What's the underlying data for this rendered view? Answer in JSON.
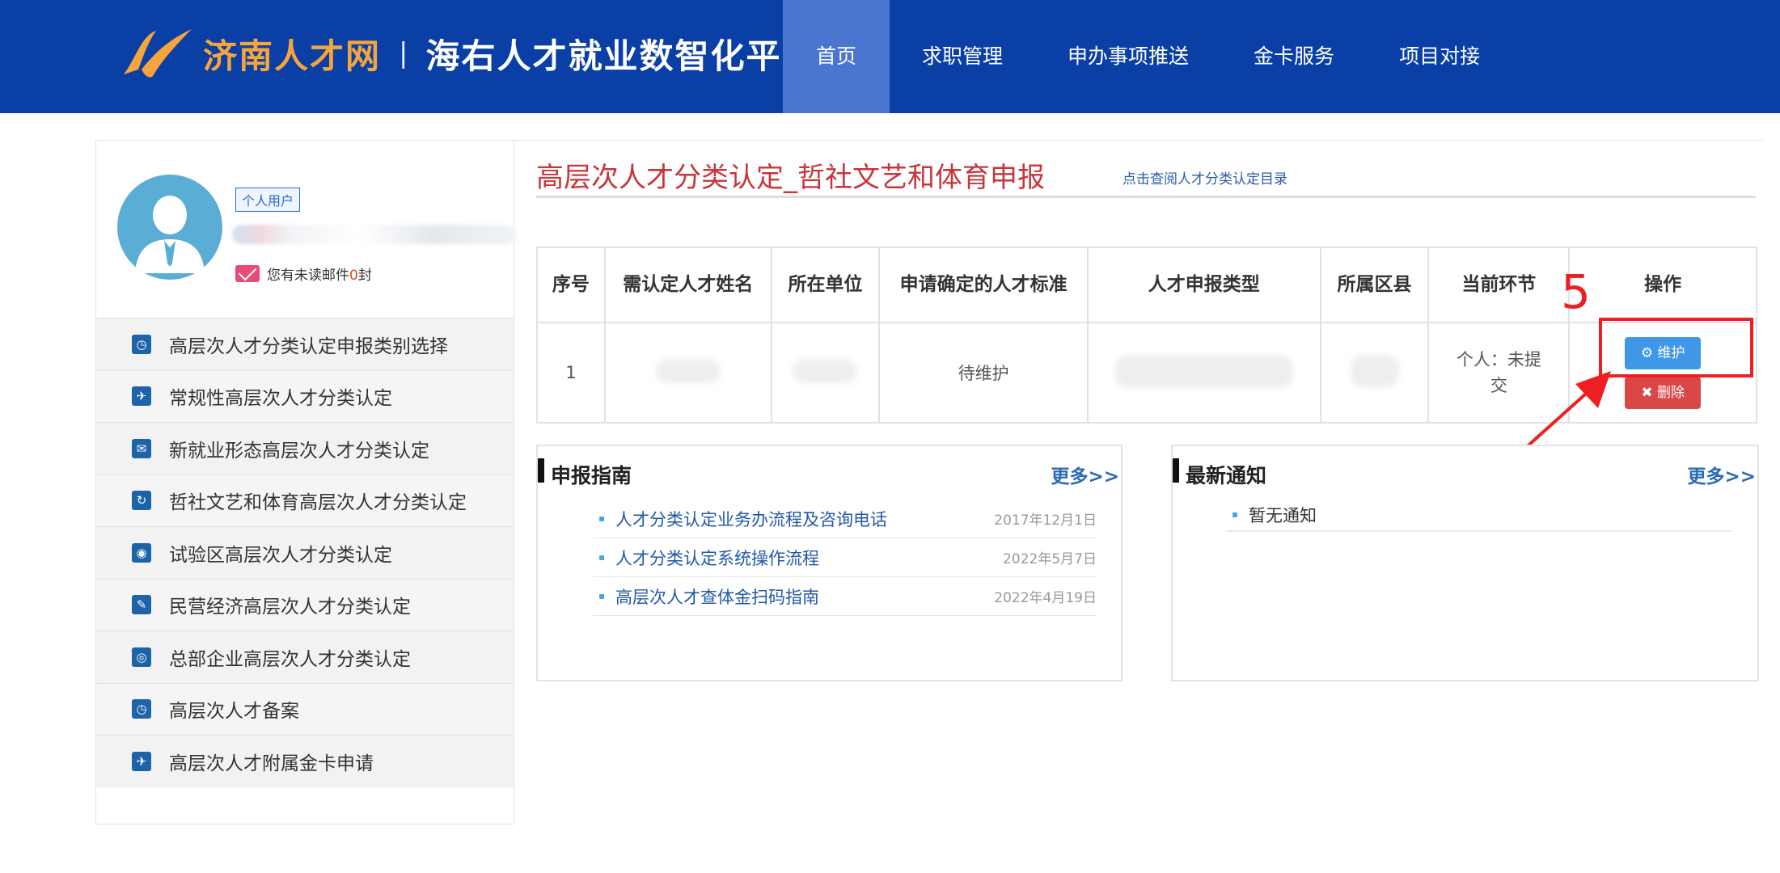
{
  "header": {
    "site_name": "济南人才网",
    "separator": "|",
    "platform_name": "海右人才就业数智化平台",
    "nav": [
      "首页",
      "求职管理",
      "申办事项推送",
      "金卡服务",
      "项目对接"
    ]
  },
  "sidebar": {
    "user_tag": "个人用户",
    "mail_prefix": "您有未读邮件",
    "mail_count": "0",
    "mail_suffix": "封",
    "menu": [
      {
        "label": "高层次人才分类认定申报类别选择"
      },
      {
        "label": "常规性高层次人才分类认定"
      },
      {
        "label": "新就业形态高层次人才分类认定"
      },
      {
        "label": "哲社文艺和体育高层次人才分类认定"
      },
      {
        "label": "试验区高层次人才分类认定"
      },
      {
        "label": "民营经济高层次人才分类认定"
      },
      {
        "label": "总部企业高层次人才分类认定"
      },
      {
        "label": "高层次人才备案"
      },
      {
        "label": "高层次人才附属金卡申请"
      }
    ]
  },
  "main": {
    "title": "高层次人才分类认定_哲社文艺和体育申报",
    "catalog_link": "点击查阅人才分类认定目录",
    "table": {
      "headers": [
        "序号",
        "需认定人才姓名",
        "所在单位",
        "申请确定的人才标准",
        "人才申报类型",
        "所属区县",
        "当前环节",
        "操作"
      ],
      "rows": [
        {
          "index": "1",
          "standard": "待维护",
          "stage": "个人：未提交",
          "maintain": "维护",
          "delete": "删除"
        }
      ]
    },
    "annotation_step": "5"
  },
  "guide_panel": {
    "title": "申报指南",
    "more": "更多>>",
    "items": [
      {
        "title": "人才分类认定业务办流程及咨询电话",
        "date": "2017年12月1日"
      },
      {
        "title": "人才分类认定系统操作流程",
        "date": "2022年5月7日"
      },
      {
        "title": "高层次人才查体金扫码指南",
        "date": "2022年4月19日"
      }
    ]
  },
  "notice_panel": {
    "title": "最新通知",
    "more": "更多>>",
    "items": [
      {
        "title": "暂无通知"
      }
    ]
  },
  "colors": {
    "header_bg": "#0a3fa6",
    "nav_active": "#4a76d0",
    "title_red": "#c8353b",
    "maintain_btn": "#3f97e7",
    "delete_btn": "#d94747",
    "annotation_red": "#ef1f21"
  }
}
